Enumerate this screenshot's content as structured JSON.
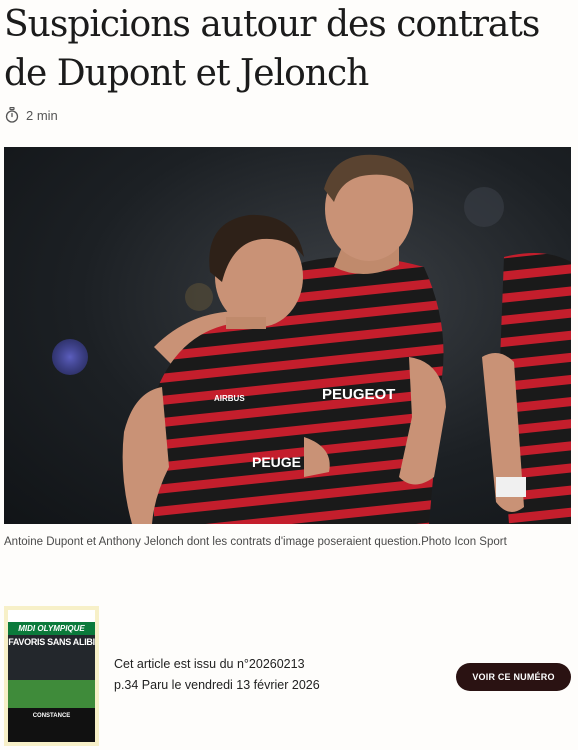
{
  "article": {
    "title_line1": "Suspicions autour des contrats",
    "title_line2": "de Dupont et Jelonch",
    "read_time": "2 min",
    "photo_caption": "Antoine Dupont et Anthony Jelonch dont les contrats d'image poseraient question.Photo Icon Sport"
  },
  "photo": {
    "jersey_sponsor": "PEUGEOT",
    "jersey_sponsor_front": "PEUGE",
    "sleeve_sponsor": "AIRBUS"
  },
  "issue": {
    "cover_brand": "MIDI OLYMPIQUE",
    "cover_headline": "FAVORIS SANS ALIBI",
    "cover_bottom": "CONSTANCE",
    "line1": "Cet article est issu du n°20260213",
    "line2": "p.34 Paru le vendredi 13 février 2026",
    "button_label": "VOIR CE NUMÉRO"
  },
  "colors": {
    "button_bg": "#2a1212",
    "cover_bg": "#f7f0c8",
    "jersey_red": "#c41e2c",
    "jersey_black": "#1a1a1a"
  },
  "icons": {
    "read_time": "stopwatch-icon"
  }
}
